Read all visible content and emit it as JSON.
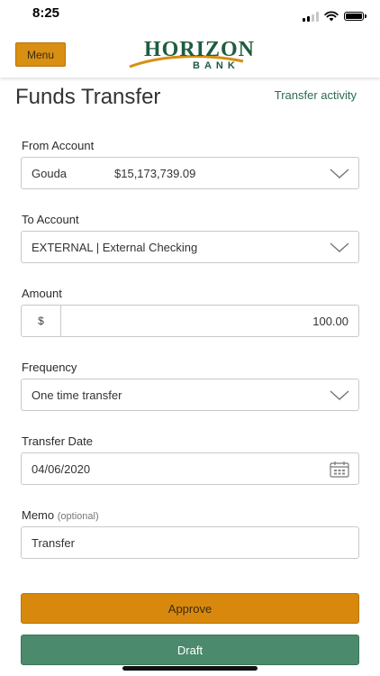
{
  "status_bar": {
    "time": "8:25"
  },
  "header": {
    "menu_label": "Menu",
    "logo_main": "HORIZON",
    "logo_sub": "BANK"
  },
  "page": {
    "title": "Funds Transfer",
    "activity_link": "Transfer activity"
  },
  "form": {
    "from_account": {
      "label": "From Account",
      "account_name": "Gouda",
      "balance": "$15,173,739.09"
    },
    "to_account": {
      "label": "To Account",
      "value": "EXTERNAL | External Checking"
    },
    "amount": {
      "label": "Amount",
      "currency": "$",
      "value": "100.00"
    },
    "frequency": {
      "label": "Frequency",
      "value": "One time transfer"
    },
    "transfer_date": {
      "label": "Transfer Date",
      "value": "04/06/2020"
    },
    "memo": {
      "label": "Memo",
      "optional_hint": "(optional)",
      "value": "Transfer"
    }
  },
  "actions": {
    "approve_label": "Approve",
    "draft_label": "Draft"
  },
  "colors": {
    "accent_orange": "#d8890d",
    "brand_green": "#1f5c40",
    "draft_green": "#4b8a6c"
  },
  "icons": {
    "dropdown": "chevron-down-icon",
    "date": "calendar-icon"
  }
}
